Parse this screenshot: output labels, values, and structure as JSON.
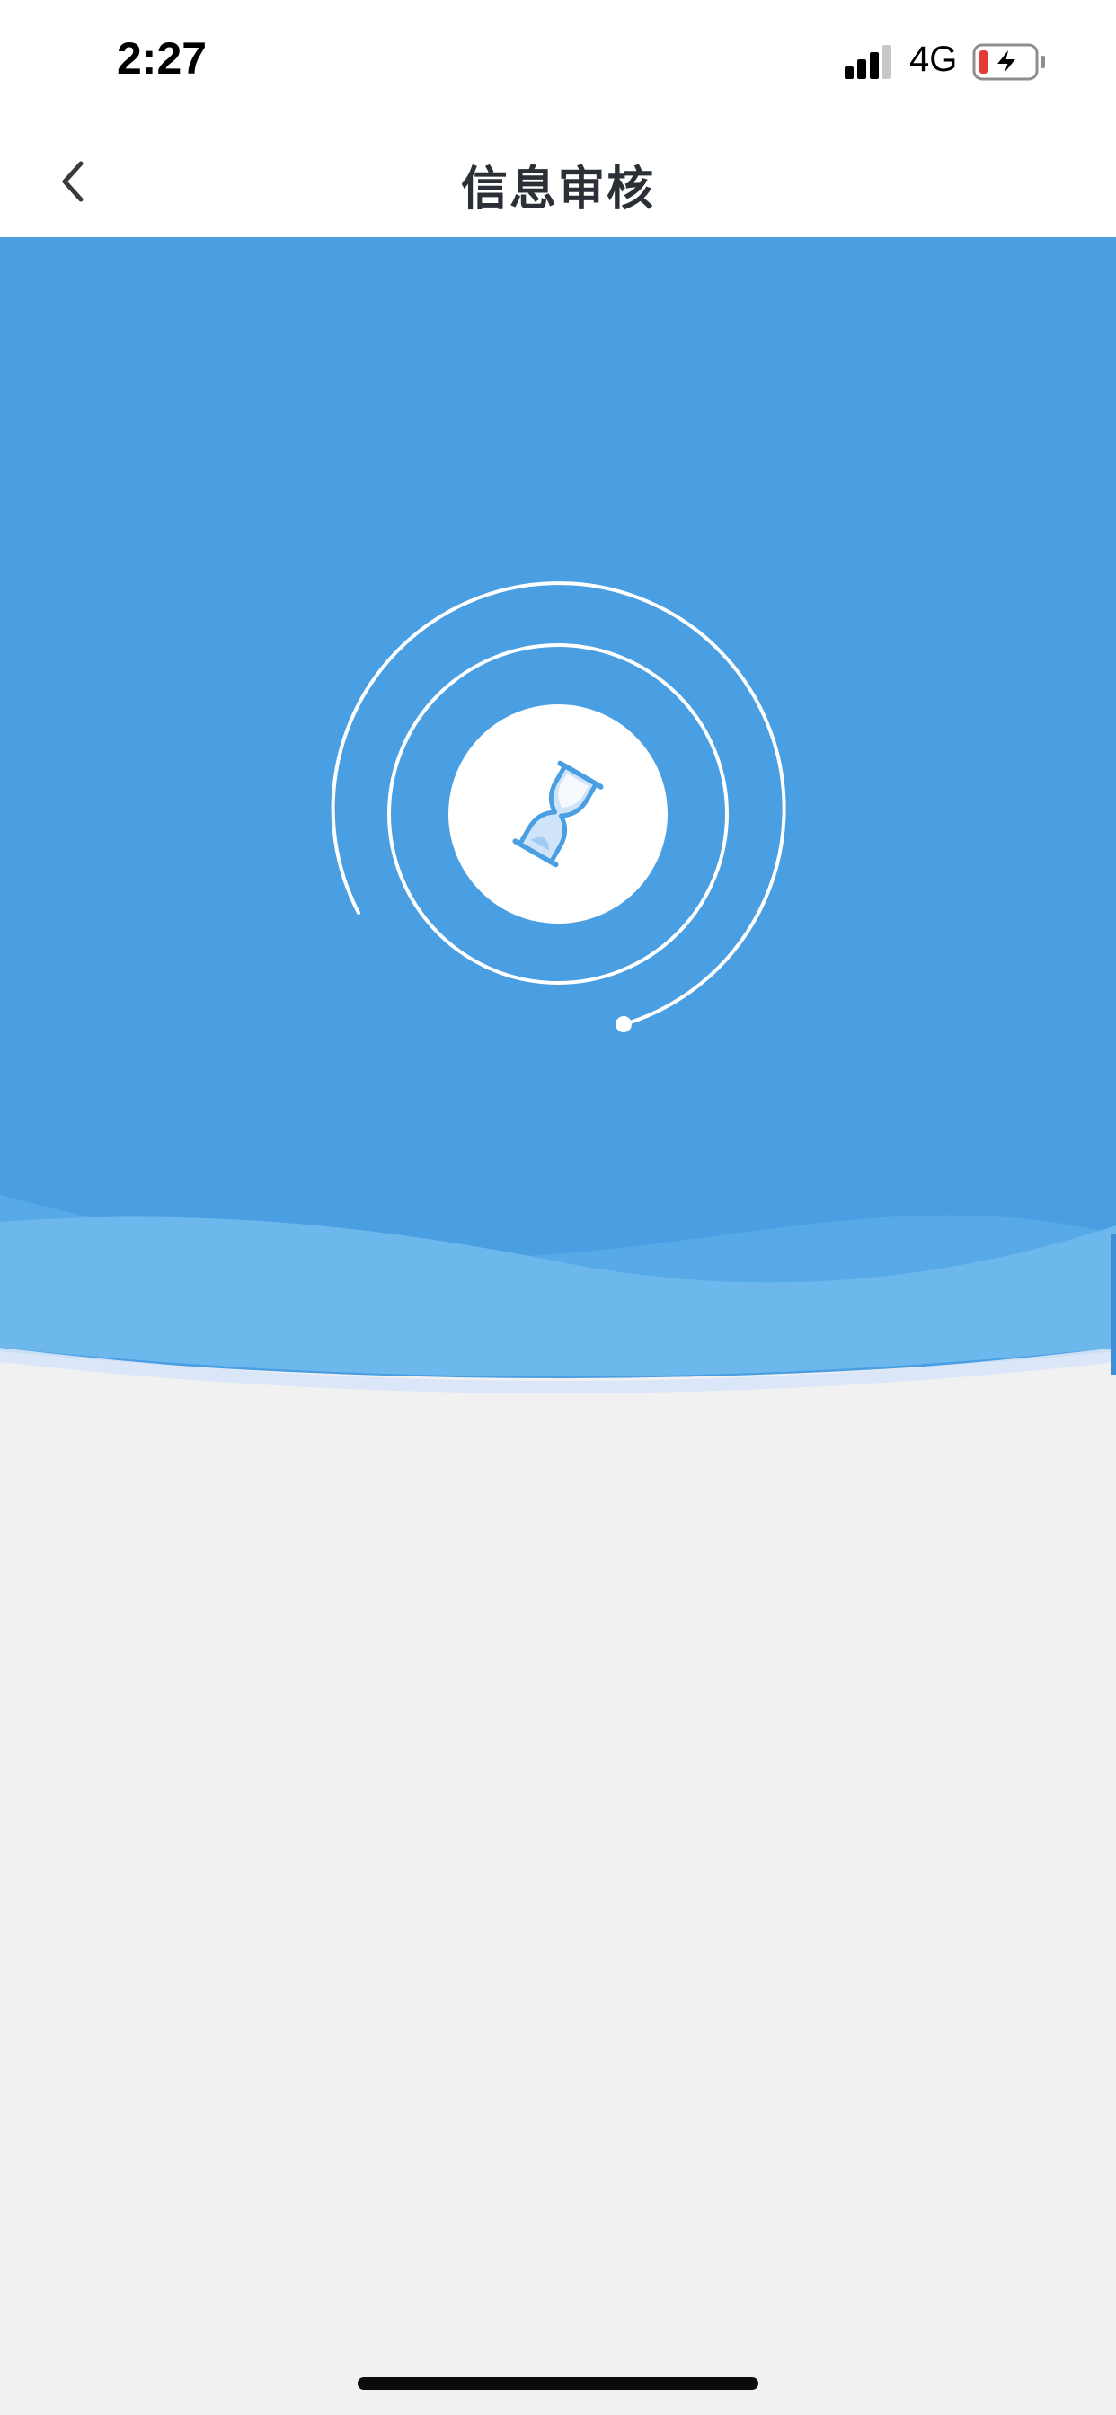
{
  "status_bar": {
    "time": "2:27",
    "network": "4G",
    "icons": [
      "signal-icon",
      "battery-charging-icon"
    ]
  },
  "nav": {
    "title": "信息审核",
    "back_icon": "chevron-left-icon"
  },
  "hero": {
    "state_icon": "hourglass-icon",
    "colors": {
      "primary": "#4a9ee2",
      "wave_light": "#6cb8ed",
      "page_bg": "#f1f1f1"
    }
  }
}
